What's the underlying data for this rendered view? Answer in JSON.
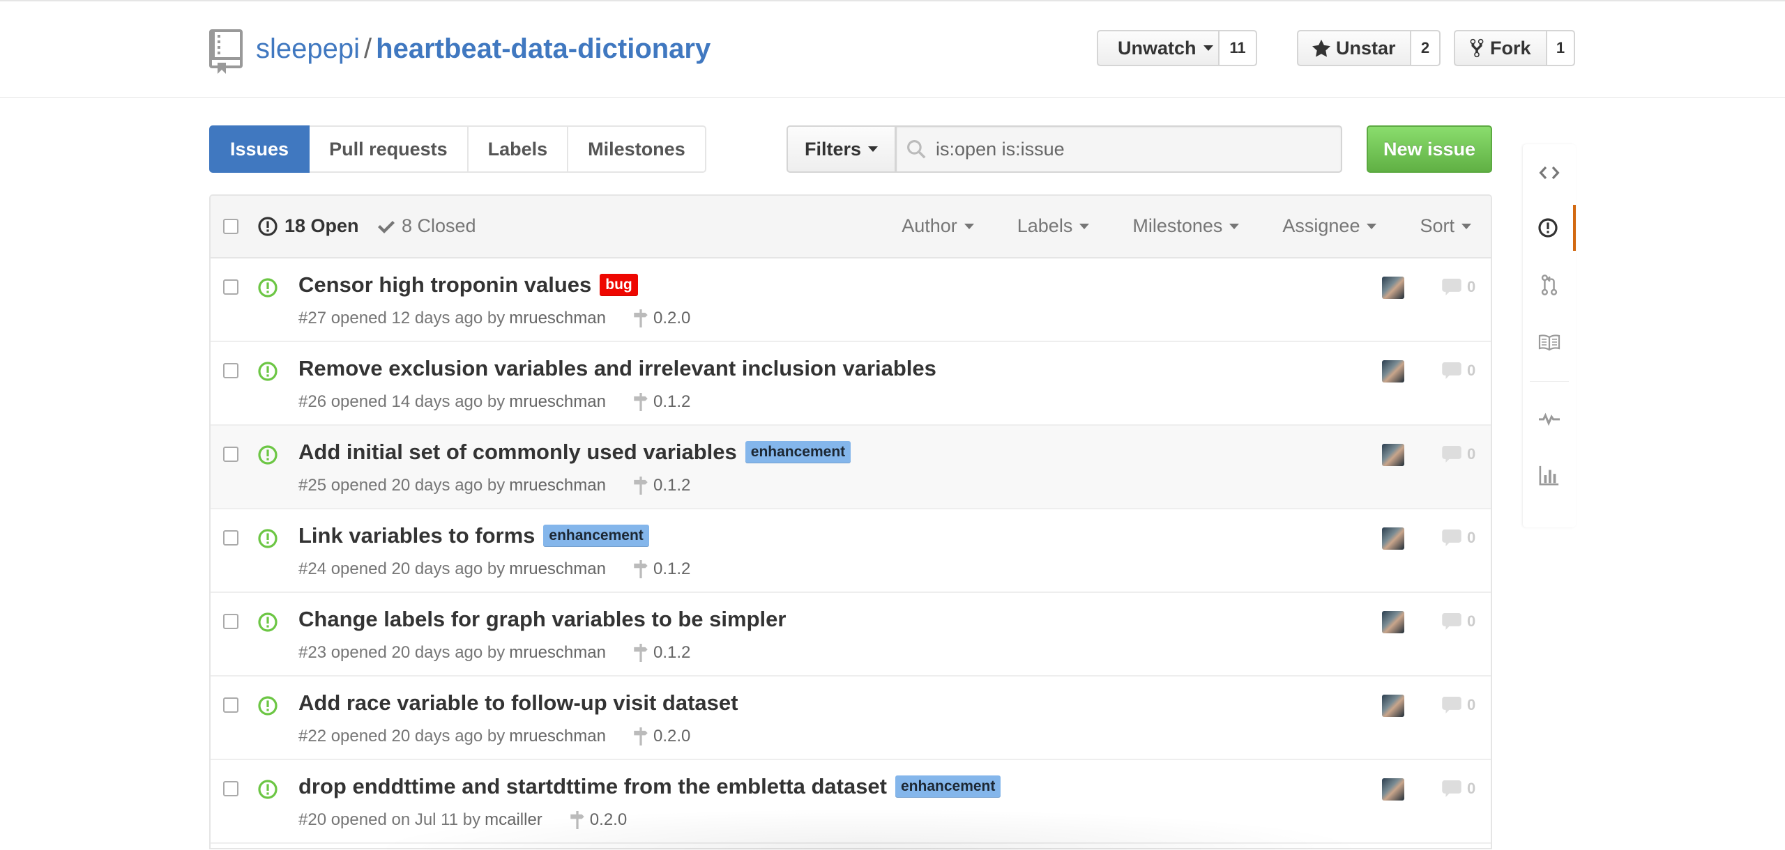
{
  "repo": {
    "owner": "sleepepi",
    "separator": "/",
    "name": "heartbeat-data-dictionary"
  },
  "actions": {
    "watch": {
      "label": "Unwatch",
      "count": "11"
    },
    "star": {
      "label": "Unstar",
      "count": "2"
    },
    "fork": {
      "label": "Fork",
      "count": "1"
    }
  },
  "subnav": {
    "issues": "Issues",
    "pulls": "Pull requests",
    "labels": "Labels",
    "milestones": "Milestones"
  },
  "filters": {
    "label": "Filters",
    "search_value": "is:open is:issue"
  },
  "new_issue": "New issue",
  "table_header": {
    "open": "18 Open",
    "closed": "8 Closed",
    "author": "Author",
    "labels": "Labels",
    "milestones": "Milestones",
    "assignee": "Assignee",
    "sort": "Sort"
  },
  "issues": [
    {
      "title": "Censor high troponin values",
      "label": "bug",
      "meta": "#27 opened 12 days ago by",
      "author": "mrueschman",
      "milestone": "0.2.0",
      "comments": "0"
    },
    {
      "title": "Remove exclusion variables and irrelevant inclusion variables",
      "label": "",
      "meta": "#26 opened 14 days ago by",
      "author": "mrueschman",
      "milestone": "0.1.2",
      "comments": "0"
    },
    {
      "title": "Add initial set of commonly used variables",
      "label": "enhancement",
      "meta": "#25 opened 20 days ago by",
      "author": "mrueschman",
      "milestone": "0.1.2",
      "comments": "0"
    },
    {
      "title": "Link variables to forms",
      "label": "enhancement",
      "meta": "#24 opened 20 days ago by",
      "author": "mrueschman",
      "milestone": "0.1.2",
      "comments": "0"
    },
    {
      "title": "Change labels for graph variables to be simpler",
      "label": "",
      "meta": "#23 opened 20 days ago by",
      "author": "mrueschman",
      "milestone": "0.1.2",
      "comments": "0"
    },
    {
      "title": "Add race variable to follow-up visit dataset",
      "label": "",
      "meta": "#22 opened 20 days ago by",
      "author": "mrueschman",
      "milestone": "0.2.0",
      "comments": "0"
    },
    {
      "title": "drop enddttime and startdttime from the embletta dataset",
      "label": "enhancement",
      "meta": "#20 opened on Jul 11 by",
      "author": "mcailler",
      "milestone": "0.2.0",
      "comments": "0"
    }
  ],
  "colors": {
    "link": "#4078c0",
    "primary": "#60b044",
    "open_icon": "#6cc644",
    "bug_label": "#ee0701",
    "enhancement_label": "#84b6eb",
    "sidenav_selected": "#d26911"
  },
  "sidenav": [
    "code-icon",
    "issue-opened-icon",
    "git-pull-request-icon",
    "book-icon",
    "pulse-icon",
    "graph-icon"
  ]
}
